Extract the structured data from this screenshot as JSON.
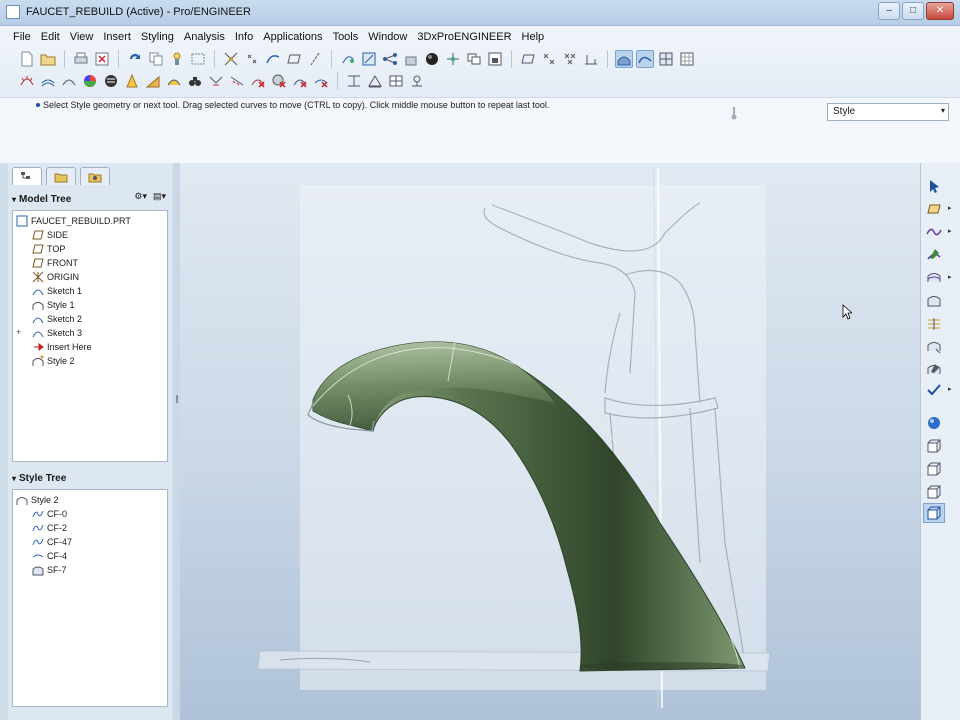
{
  "window": {
    "title": "FAUCET_REBUILD (Active) - Pro/ENGINEER",
    "minimize": "–",
    "maximize": "□",
    "close": "✕"
  },
  "menu": [
    "File",
    "Edit",
    "View",
    "Insert",
    "Styling",
    "Analysis",
    "Info",
    "Applications",
    "Tools",
    "Window",
    "3DxProENGINEER",
    "Help"
  ],
  "message": {
    "text": "Select Style geometry or next tool. Drag selected curves to move (CTRL to copy). Click middle mouse button to repeat last tool."
  },
  "filter": {
    "selected": "Style",
    "arrow": "▾"
  },
  "model_tree": {
    "header": "Model Tree",
    "items": [
      {
        "label": "FAUCET_REBUILD.PRT",
        "icon": "part-icon"
      },
      {
        "label": "SIDE",
        "icon": "datum-plane-icon"
      },
      {
        "label": "TOP",
        "icon": "datum-plane-icon"
      },
      {
        "label": "FRONT",
        "icon": "datum-plane-icon"
      },
      {
        "label": "ORIGIN",
        "icon": "coordinate-system-icon"
      },
      {
        "label": "Sketch 1",
        "icon": "sketch-icon"
      },
      {
        "label": "Style 1",
        "icon": "style-feature-icon"
      },
      {
        "label": "Sketch 2",
        "icon": "sketch-icon"
      },
      {
        "label": "Sketch 3",
        "icon": "sketch-icon"
      },
      {
        "label": "Insert Here",
        "icon": "insert-arrow-icon"
      },
      {
        "label": "Style 2",
        "icon": "style-feature-icon"
      }
    ]
  },
  "style_tree": {
    "header": "Style Tree",
    "items": [
      {
        "label": "Style 2",
        "icon": "style-feature-icon"
      },
      {
        "label": "CF-0",
        "icon": "curve-icon"
      },
      {
        "label": "CF-2",
        "icon": "curve-icon"
      },
      {
        "label": "CF-47",
        "icon": "curve-icon"
      },
      {
        "label": "CF-4",
        "icon": "curve-icon"
      },
      {
        "label": "SF-7",
        "icon": "surface-icon"
      }
    ]
  },
  "colors": {
    "accent": "#2a5fb0",
    "surface_green": "#4f6b42",
    "viewport_top": "#e1e9f2",
    "viewport_bottom": "#afc2d9"
  }
}
